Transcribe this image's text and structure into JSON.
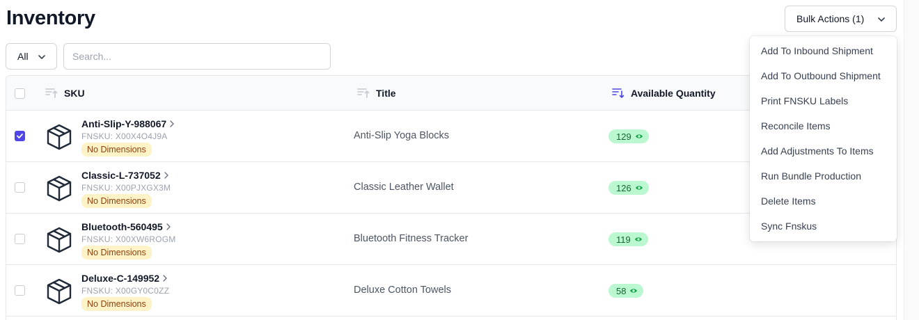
{
  "header": {
    "title": "Inventory",
    "bulk_actions_label": "Bulk Actions (1)"
  },
  "filters": {
    "select_value": "All",
    "search_placeholder": "Search...",
    "search_value": ""
  },
  "table": {
    "columns": {
      "sku": "SKU",
      "title": "Title",
      "available_quantity": "Available Quantity"
    },
    "rows": [
      {
        "checked": true,
        "sku": "Anti-Slip-Y-988067",
        "fnsku": "FNSKU: X00X4O4J9A",
        "badge": "No Dimensions",
        "title": "Anti-Slip Yoga Blocks",
        "quantity": "129"
      },
      {
        "checked": false,
        "sku": "Classic-L-737052",
        "fnsku": "FNSKU: X00PJXGX3M",
        "badge": "No Dimensions",
        "title": "Classic Leather Wallet",
        "quantity": "126"
      },
      {
        "checked": false,
        "sku": "Bluetooth-560495",
        "fnsku": "FNSKU: X00XW6ROGM",
        "badge": "No Dimensions",
        "title": "Bluetooth Fitness Tracker",
        "quantity": "119"
      },
      {
        "checked": false,
        "sku": "Deluxe-C-149952",
        "fnsku": "FNSKU: X00GY0C0ZZ",
        "badge": "No Dimensions",
        "title": "Deluxe Cotton Towels",
        "quantity": "58"
      }
    ]
  },
  "bulk_menu": {
    "items": [
      "Add To Inbound Shipment",
      "Add To Outbound Shipment",
      "Print FNSKU Labels",
      "Reconcile Items",
      "Add Adjustments To Items",
      "Run Bundle Production",
      "Delete Items",
      "Sync Fnskus"
    ]
  },
  "colors": {
    "accent": "#4f46e5",
    "badge_warning_bg": "#fef3c7",
    "badge_warning_text": "#92400e",
    "qty_bg": "#bbf7d0",
    "qty_text": "#166534"
  },
  "icons": {
    "row_icon": "package-box-icon",
    "sort_icon": "sort-ascending-icon",
    "active_sort_icon": "sort-descending-icon",
    "qty_icon": "eye-icon",
    "chevron": "chevron-down-icon"
  }
}
